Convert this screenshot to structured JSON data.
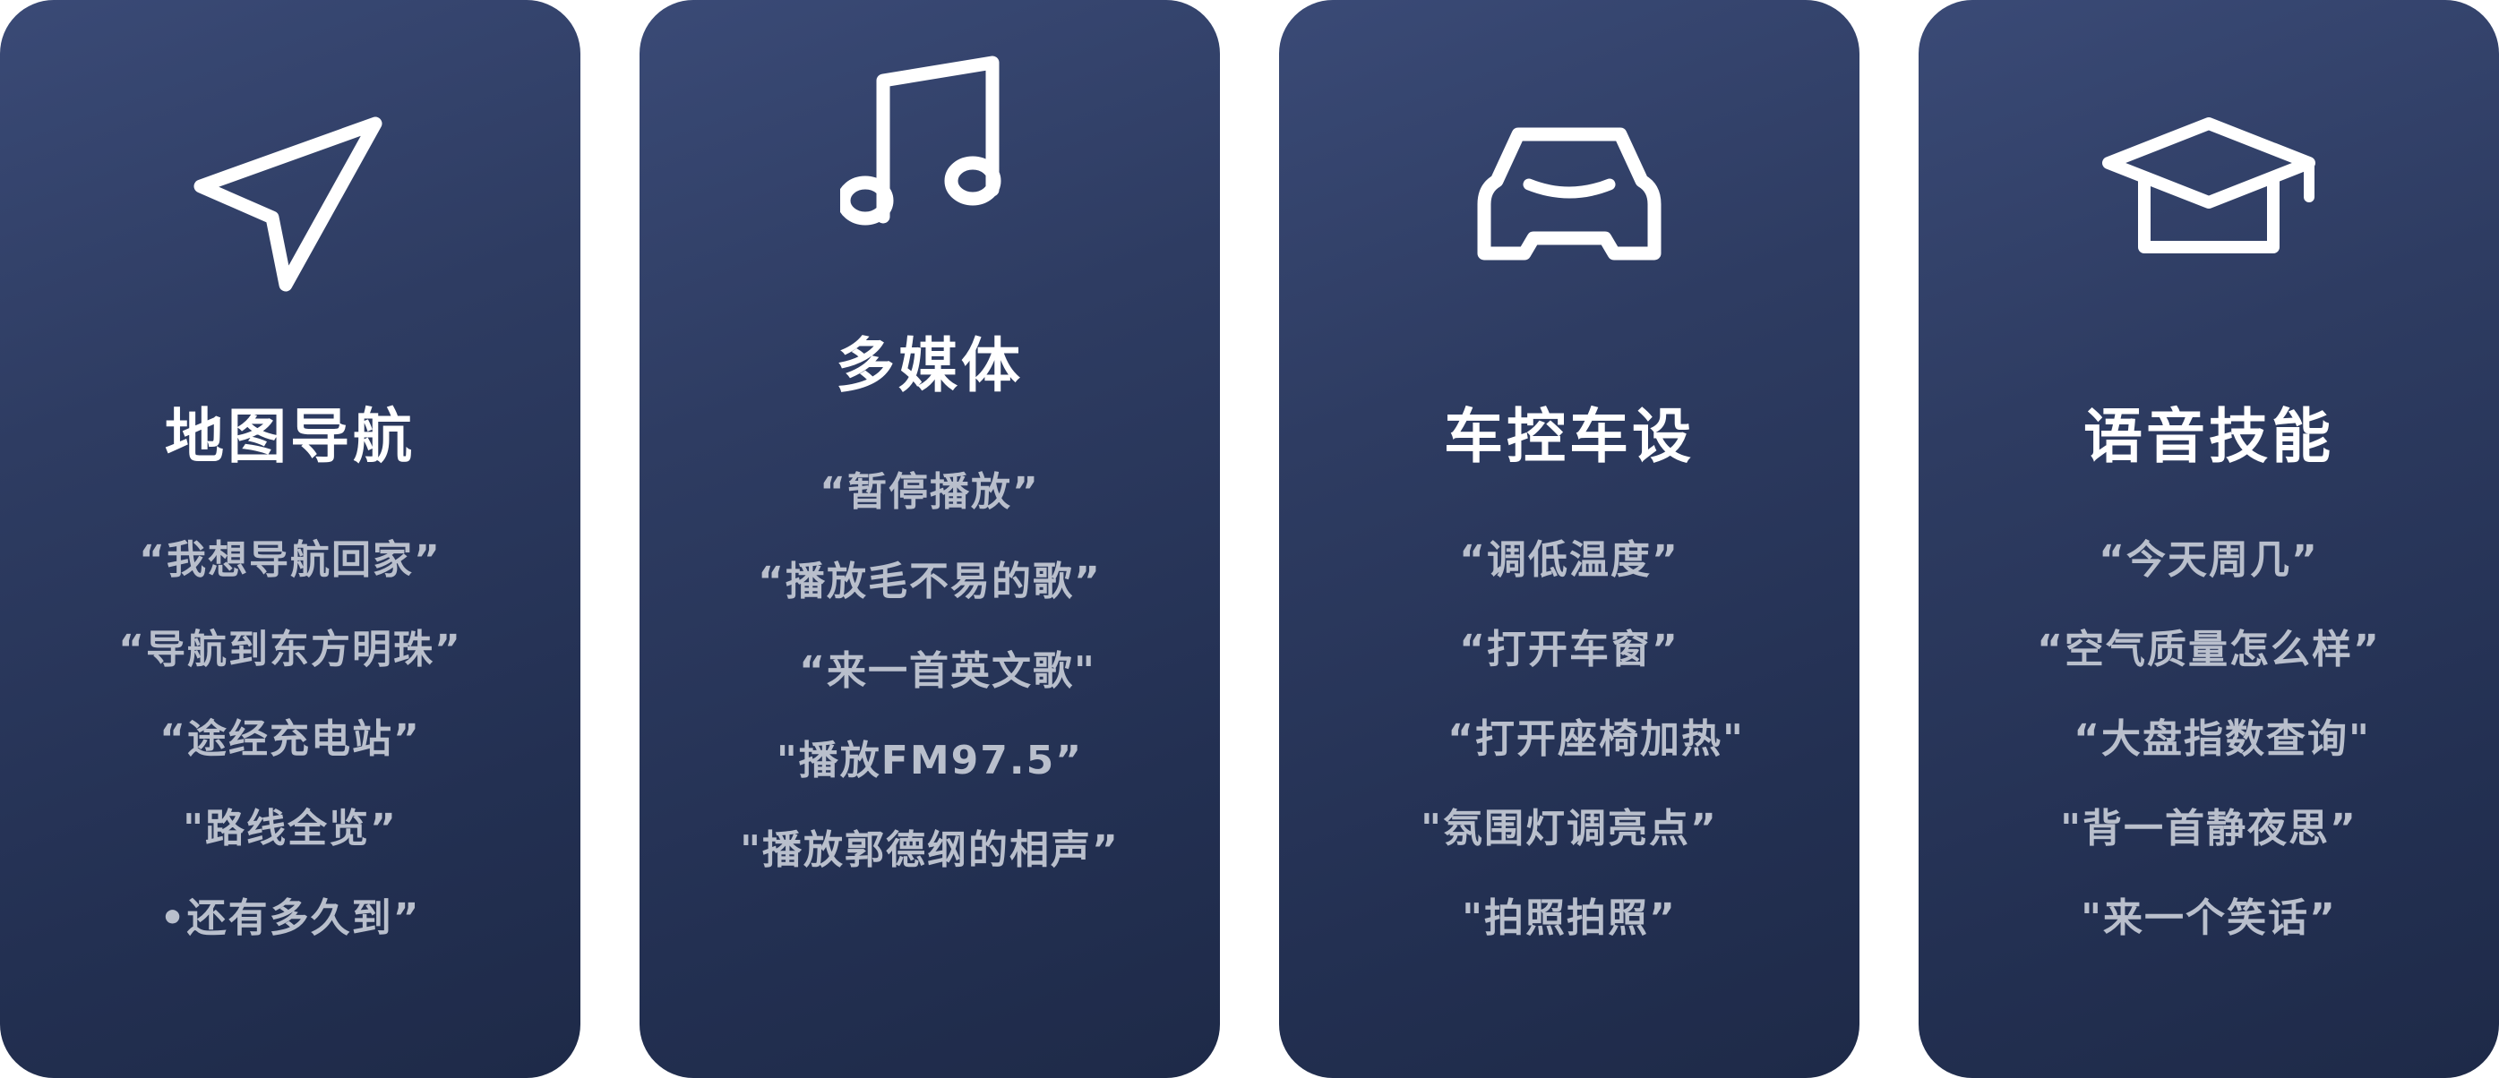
{
  "cards": [
    {
      "icon": "navigation-arrow-icon",
      "title": "地图导航",
      "commands": [
        "“我想导航回家”",
        "“导航到东方明珠”",
        "“途经充电站”",
        "\"路线全览”",
        "•还有多久到”"
      ]
    },
    {
      "icon": "music-note-icon",
      "title": "多媒体",
      "commands": [
        "“暂停播放”",
        "“播放毛不易的歌”",
        "“来一首英文歌\"",
        "\"播放FM97.5”",
        "\"播放郭德纲的相声”"
      ]
    },
    {
      "icon": "car-icon",
      "title": "车控车设",
      "commands": [
        "“调低温度”",
        "“打开车窗”",
        "“打开座椅加热\"",
        "\"氛围灯调亮点”",
        "\"拍照拍照”"
      ]
    },
    {
      "icon": "graduation-cap-icon",
      "title": "语音技能",
      "commands": [
        "“今天周几”",
        "“空气质量怎么样”",
        "“大盘指数查询\"",
        "\"背一首静夜思”",
        "\"来一个笑话”"
      ]
    }
  ]
}
